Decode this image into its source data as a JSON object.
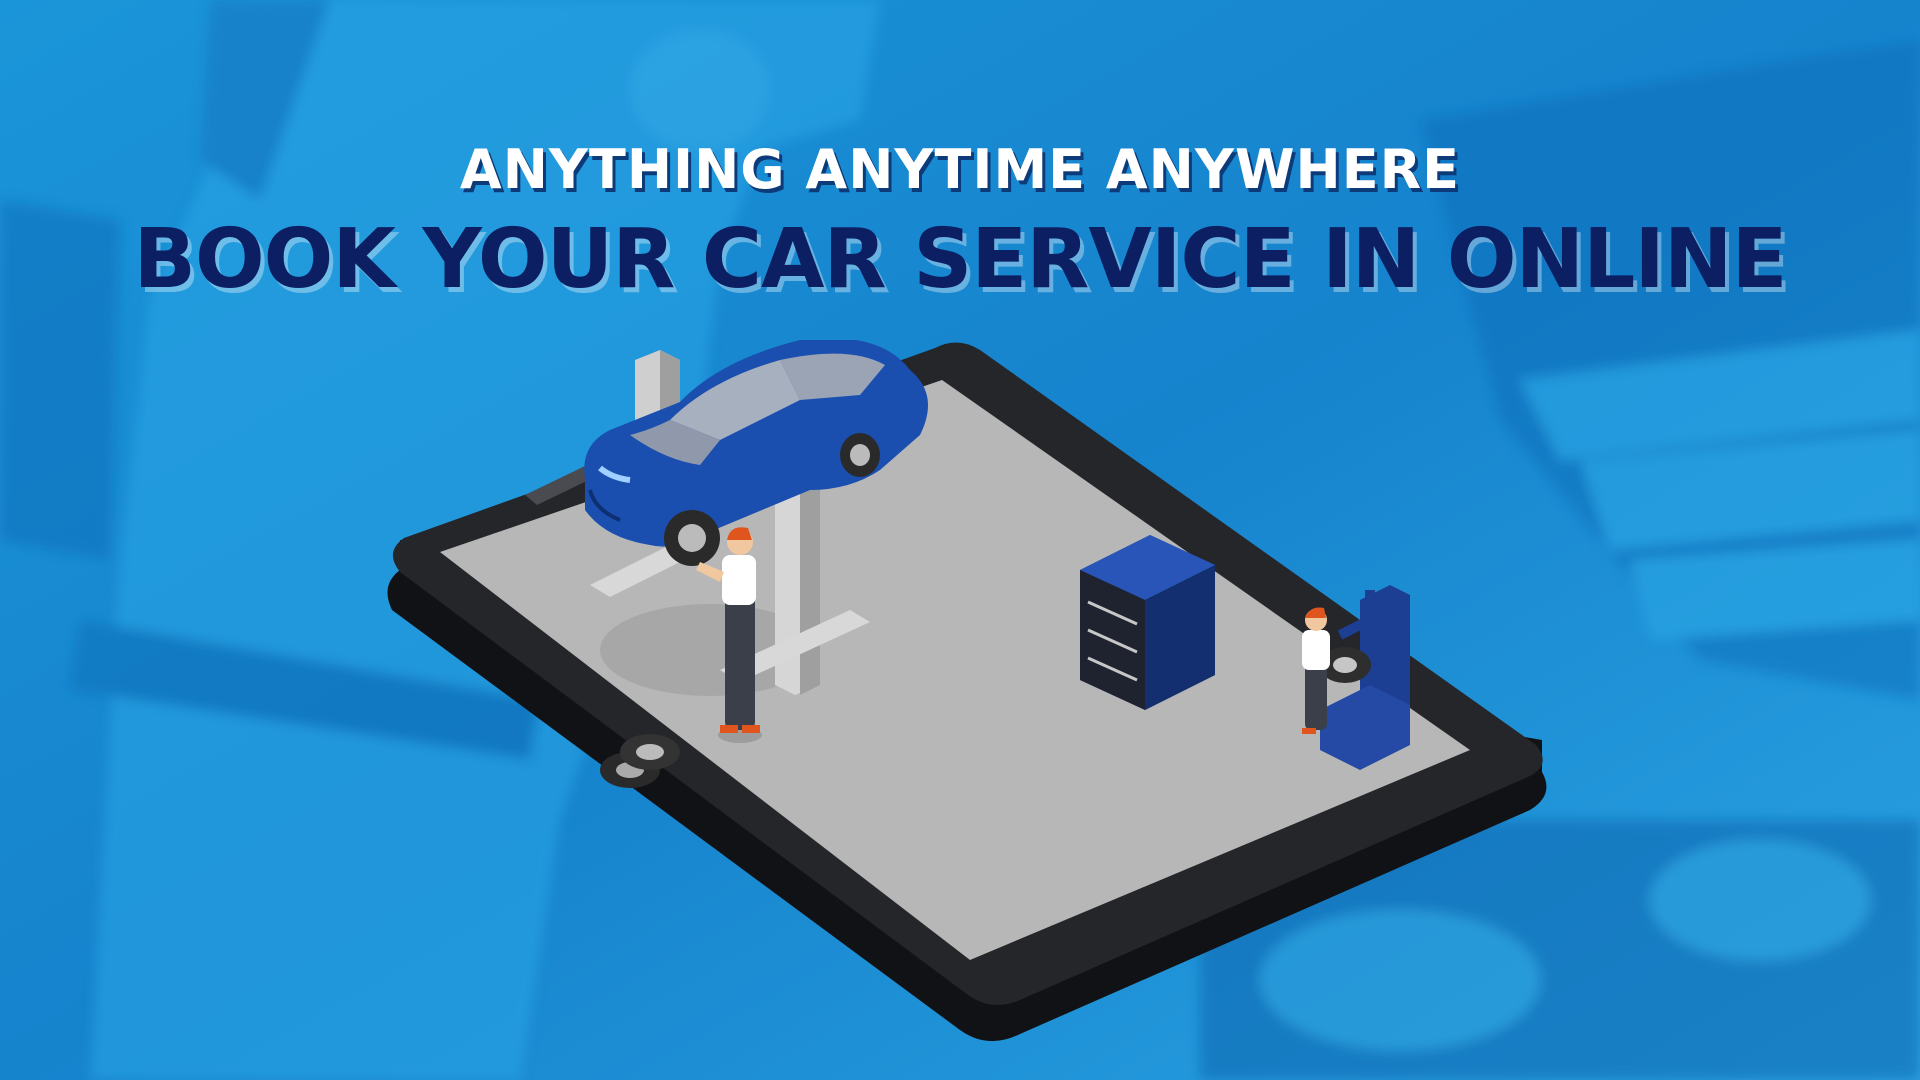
{
  "headline": {
    "tagline": "ANYTHING ANYTIME ANYWHERE",
    "title": "BOOK YOUR CAR SERVICE IN ONLINE"
  },
  "colors": {
    "background": "#1591d6",
    "title_text": "#0b1f62",
    "tagline_text": "#ffffff",
    "phone_body": "#232427",
    "phone_screen": "#b7b7b7",
    "car_body": "#1a4fb0",
    "cabinet": "#1c3f93",
    "mechanic_shirt": "#ffffff",
    "mechanic_hair": "#e0551e"
  },
  "icons": {
    "car": "car-on-lift-icon",
    "phone": "smartphone-icon",
    "cabinet": "tool-cabinet-icon",
    "tires": "tire-stack-icon",
    "tire_machine": "tire-changer-icon"
  }
}
